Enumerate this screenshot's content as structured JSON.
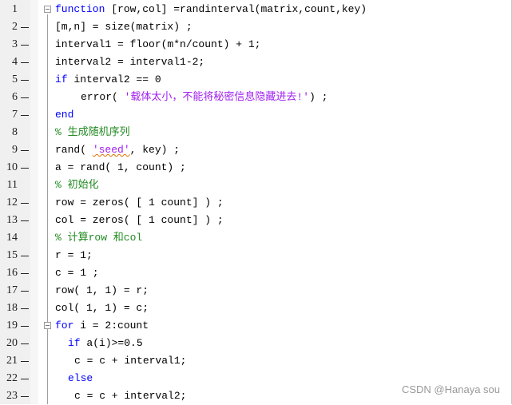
{
  "editor": {
    "lines": [
      {
        "n": "1",
        "dash": false,
        "fold": true,
        "indent": 0,
        "parts": [
          {
            "t": "kw",
            "v": "function"
          },
          {
            "t": "",
            "v": " [row,col] =randinterval(matrix,count,key)"
          }
        ]
      },
      {
        "n": "2",
        "dash": true,
        "fold": false,
        "indent": 0,
        "parts": [
          {
            "t": "",
            "v": "[m,n] = size(matrix) ;"
          }
        ]
      },
      {
        "n": "3",
        "dash": true,
        "fold": false,
        "indent": 0,
        "parts": [
          {
            "t": "",
            "v": "interval1 = floor(m*n/count) + 1;"
          }
        ]
      },
      {
        "n": "4",
        "dash": true,
        "fold": false,
        "indent": 0,
        "parts": [
          {
            "t": "",
            "v": "interval2 = interval1-2;"
          }
        ]
      },
      {
        "n": "5",
        "dash": true,
        "fold": false,
        "indent": 0,
        "parts": [
          {
            "t": "kw",
            "v": "if"
          },
          {
            "t": "",
            "v": " interval2 == 0"
          }
        ]
      },
      {
        "n": "6",
        "dash": true,
        "fold": false,
        "indent": 4,
        "parts": [
          {
            "t": "",
            "v": "error( "
          },
          {
            "t": "str",
            "v": "'载体太小，不能将秘密信息隐藏进去!'"
          },
          {
            "t": "",
            "v": ") ;"
          }
        ]
      },
      {
        "n": "7",
        "dash": true,
        "fold": false,
        "indent": 0,
        "parts": [
          {
            "t": "kw",
            "v": "end"
          }
        ]
      },
      {
        "n": "8",
        "dash": false,
        "fold": false,
        "indent": 0,
        "parts": [
          {
            "t": "cm",
            "v": "% 生成随机序列"
          }
        ]
      },
      {
        "n": "9",
        "dash": true,
        "fold": false,
        "indent": 0,
        "parts": [
          {
            "t": "",
            "v": "rand( "
          },
          {
            "t": "str squig",
            "v": "'seed'"
          },
          {
            "t": "",
            "v": ", key) ;"
          }
        ]
      },
      {
        "n": "10",
        "dash": true,
        "fold": false,
        "indent": 0,
        "parts": [
          {
            "t": "",
            "v": "a = rand( 1, count) ;"
          }
        ]
      },
      {
        "n": "11",
        "dash": false,
        "fold": false,
        "indent": 0,
        "parts": [
          {
            "t": "cm",
            "v": "% 初始化"
          }
        ]
      },
      {
        "n": "12",
        "dash": true,
        "fold": false,
        "indent": 0,
        "parts": [
          {
            "t": "",
            "v": "row = zeros( [ 1 count] ) ;"
          }
        ]
      },
      {
        "n": "13",
        "dash": true,
        "fold": false,
        "indent": 0,
        "parts": [
          {
            "t": "",
            "v": "col = zeros( [ 1 count] ) ;"
          }
        ]
      },
      {
        "n": "14",
        "dash": false,
        "fold": false,
        "indent": 0,
        "parts": [
          {
            "t": "cm",
            "v": "% 计算row 和col"
          }
        ]
      },
      {
        "n": "15",
        "dash": true,
        "fold": false,
        "indent": 0,
        "parts": [
          {
            "t": "",
            "v": "r = 1;"
          }
        ]
      },
      {
        "n": "16",
        "dash": true,
        "fold": false,
        "indent": 0,
        "parts": [
          {
            "t": "",
            "v": "c = 1 ;"
          }
        ]
      },
      {
        "n": "17",
        "dash": true,
        "fold": false,
        "indent": 0,
        "parts": [
          {
            "t": "",
            "v": "row( 1, 1) = r;"
          }
        ]
      },
      {
        "n": "18",
        "dash": true,
        "fold": false,
        "indent": 0,
        "parts": [
          {
            "t": "",
            "v": "col( 1, 1) = c;"
          }
        ]
      },
      {
        "n": "19",
        "dash": true,
        "fold": true,
        "indent": 0,
        "parts": [
          {
            "t": "kw",
            "v": "for"
          },
          {
            "t": "",
            "v": " i = 2:count"
          }
        ]
      },
      {
        "n": "20",
        "dash": true,
        "fold": false,
        "indent": 2,
        "parts": [
          {
            "t": "kw",
            "v": "if"
          },
          {
            "t": "",
            "v": " a(i)>=0.5"
          }
        ]
      },
      {
        "n": "21",
        "dash": true,
        "fold": false,
        "indent": 3,
        "parts": [
          {
            "t": "",
            "v": "c = c + interval1;"
          }
        ]
      },
      {
        "n": "22",
        "dash": true,
        "fold": false,
        "indent": 2,
        "parts": [
          {
            "t": "kw",
            "v": "else"
          }
        ]
      },
      {
        "n": "23",
        "dash": true,
        "fold": false,
        "indent": 3,
        "parts": [
          {
            "t": "",
            "v": "c = c + interval2;"
          }
        ]
      }
    ]
  },
  "watermark": "CSDN @Hanaya sou"
}
